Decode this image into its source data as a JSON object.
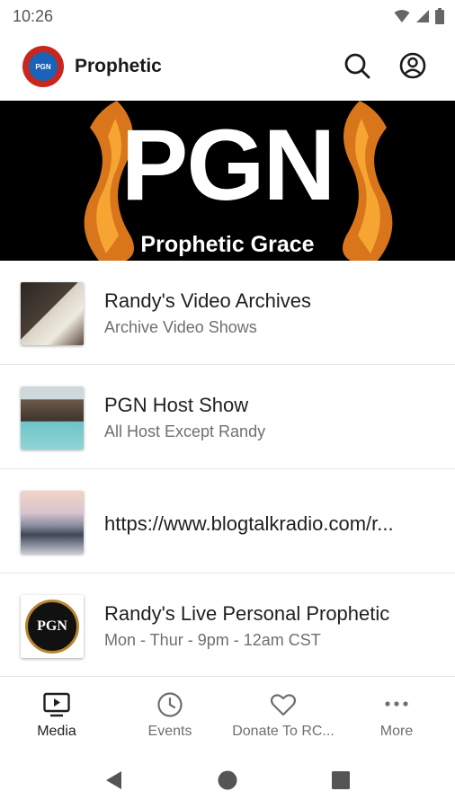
{
  "status_bar": {
    "time": "10:26"
  },
  "app_bar": {
    "title": "Prophetic",
    "logo_text": "PGN"
  },
  "banner": {
    "title": "PGN",
    "subtitle": "Prophetic Grace"
  },
  "list": [
    {
      "title": "Randy's Video Archives",
      "subtitle": "Archive Video Shows",
      "thumb_icon": "bible-desk-thumbnail"
    },
    {
      "title": "PGN Host Show",
      "subtitle": "All Host Except Randy",
      "thumb_icon": "coastline-thumbnail"
    },
    {
      "title": "https://www.blogtalkradio.com/r...",
      "subtitle": "",
      "thumb_icon": "clouds-thumbnail"
    },
    {
      "title": "Randy's Live Personal Prophetic",
      "subtitle": "Mon - Thur - 9pm - 12am CST",
      "thumb_icon": "pgn-logo-thumbnail",
      "thumb_text": "PGN"
    }
  ],
  "bottom_nav": [
    {
      "label": "Media",
      "icon": "media-icon",
      "active": true
    },
    {
      "label": "Events",
      "icon": "clock-icon"
    },
    {
      "label": "Donate To RC...",
      "icon": "heart-icon"
    },
    {
      "label": "More",
      "icon": "more-icon"
    }
  ],
  "colors": {
    "accent": "#1f1f1f",
    "muted": "#6f6f6f",
    "logo_ring": "#c7271f",
    "logo_fill": "#1a63b8"
  }
}
